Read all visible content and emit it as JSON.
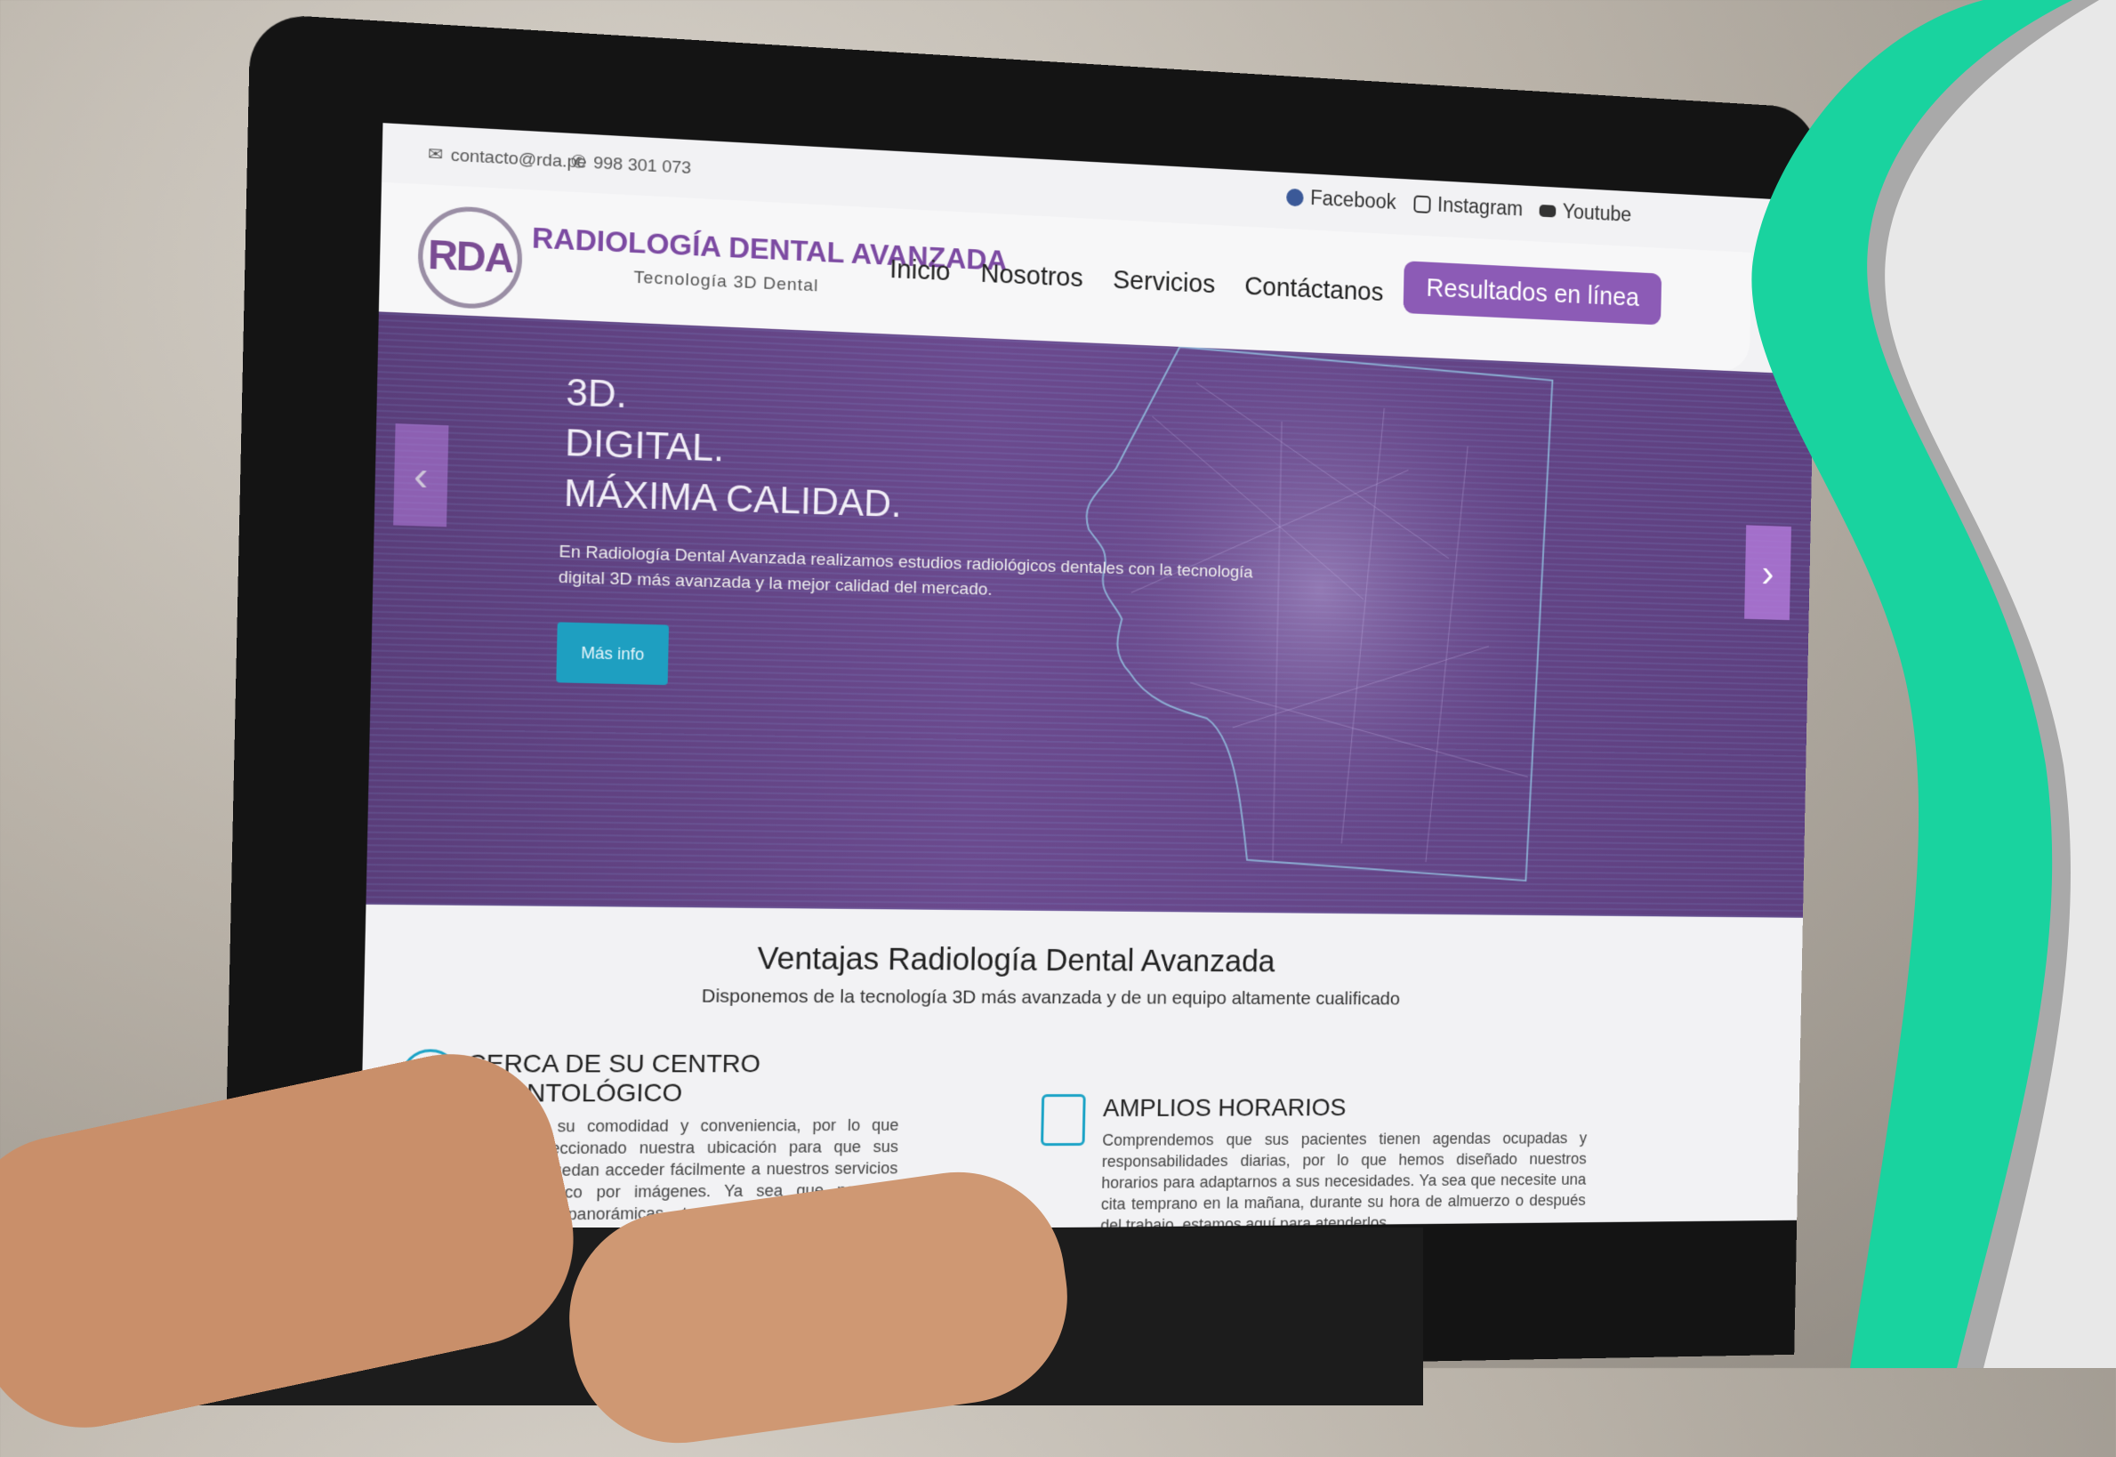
{
  "topbar": {
    "email": "contacto@rda.pe",
    "phone": "998 301 073",
    "social": [
      {
        "label": "Facebook",
        "icon": "facebook-icon"
      },
      {
        "label": "Instagram",
        "icon": "instagram-icon"
      },
      {
        "label": "Youtube",
        "icon": "youtube-icon"
      }
    ]
  },
  "header": {
    "logo_text": "RDA",
    "brand": "RADIOLOGÍA DENTAL AVANZADA",
    "tagline": "Tecnología 3D Dental",
    "nav": [
      "Inicio",
      "Nosotros",
      "Servicios",
      "Contáctanos"
    ],
    "cta": "Resultados en línea"
  },
  "hero": {
    "lines": [
      "3D.",
      "DIGITAL.",
      "MÁXIMA CALIDAD."
    ],
    "text": "En Radiología Dental Avanzada realizamos estudios radiológicos dentales con la tecnología digital 3D más avanzada y la mejor calidad del mercado.",
    "button": "Más info"
  },
  "advantages": {
    "title": "Ventajas Radiología Dental Avanzada",
    "subtitle": "Disponemos de la tecnología 3D más avanzada y de un equipo altamente cualificado",
    "items": [
      {
        "heading": "CERCA DE SU CENTRO ODONTOLÓGICO",
        "text": "Valoramos su comodidad y conveniencia, por lo que hemos seleccionado nuestra ubicación para que sus pacientes puedan acceder fácilmente a nuestros servicios de diagnóstico por imágenes. Ya sea que necesite radiografías panorámicas, tomografías cone beam o cualquier otro estudio radiológico, estamos a solo unos minutos de distancia."
      },
      {
        "heading": "AMPLIOS HORARIOS",
        "text": "Comprendemos que sus pacientes tienen agendas ocupadas y responsabilidades diarias, por lo que hemos diseñado nuestros horarios para adaptarnos a sus necesidades. Ya sea que necesite una cita temprano en la mañana, durante su hora de almuerzo o después del trabajo, estamos aquí para atenderlos."
      }
    ]
  },
  "colors": {
    "brand_purple": "#8c5bb6",
    "hero_purple": "#5e4080",
    "accent_green": "#19d39f",
    "button_blue": "#1e9fc1"
  }
}
